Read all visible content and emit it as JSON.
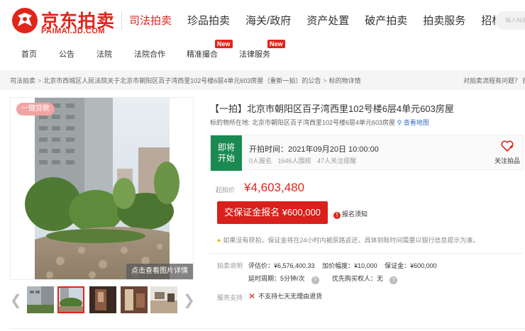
{
  "header": {
    "logo_cn": "京东拍卖",
    "logo_en": "PAIMAI.JD.COM",
    "nav": [
      "司法拍卖",
      "珍品拍卖",
      "海关/政府",
      "资产处置",
      "破产拍卖",
      "拍卖服务",
      "招标采购"
    ],
    "active_nav": 0,
    "search_placeholder": "输入标的物名称"
  },
  "sub_nav": {
    "items": [
      "首页",
      "公告",
      "法院",
      "法院合作",
      "精准撮合",
      "法律服务"
    ],
    "badge_text": "New"
  },
  "breadcrumb": {
    "items": [
      "司法拍卖",
      "北京市西城区人民法院关于北京市朝阳区百子湾西里102号楼6层4单元603房屋（重新一拍）的公告",
      "标的物详情"
    ],
    "help": "对拍卖流程有问题？ 拍"
  },
  "gallery": {
    "loan_tag": "一键贷款",
    "view_details": "点击查看图片详情"
  },
  "item": {
    "title": "【一拍】北京市朝阳区百子湾西里102号楼6层4单元603房屋",
    "address_label": "标的物所在地:",
    "address": "北京市朝阳区百子湾西里102号楼6层4单元603房屋",
    "map_link": "查看地图"
  },
  "status": {
    "tag_line1": "即将",
    "tag_line2": "开始",
    "start_time": "开拍时间：2021年09月20日 10:00:00",
    "signups": "0人报名",
    "views": "1646人围观",
    "follows": "47人关注提醒",
    "follow_label": "关注拍品"
  },
  "price": {
    "start_label": "起拍价",
    "start_price": "¥4,603,480",
    "deposit_button": "交保证金报名 ¥600,000",
    "notice": "报名须知",
    "refund_tip": "如果没有获拍，保证金将在24小时内被原路返还，具体到账时间需要以银行信息提示为准。"
  },
  "rules": {
    "label": "拍卖说明",
    "appraisal": "评估价：¥6,576,400.33",
    "increment": "加价幅度：¥10,000",
    "deposit": "保证金：¥600,000",
    "extension": "延时周期：5分钟/次",
    "priority": "优先购买权人：无"
  },
  "service": {
    "label": "服务支持",
    "value": "不支持七天无理由退货"
  },
  "colors": {
    "brand_red": "#e1251b",
    "status_green": "#1a8a52",
    "link_blue": "#3a6fc4"
  }
}
